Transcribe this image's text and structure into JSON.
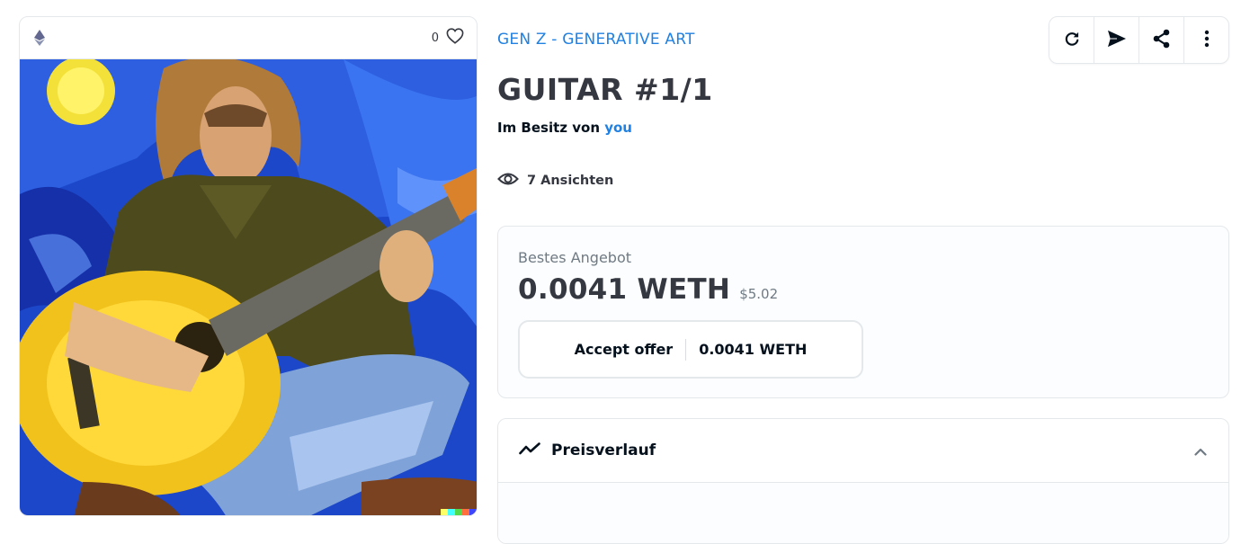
{
  "item": {
    "favorites_count": "0",
    "collection_name": "GEN Z - GENERATIVE ART",
    "title": "GUITAR #1/1",
    "owner_prefix": "Im Besitz von ",
    "owner_name": "you",
    "views_text": "7 Ansichten"
  },
  "toolbar": {
    "buttons": [
      "refresh-icon",
      "send-icon",
      "share-icon",
      "more-vertical-icon"
    ]
  },
  "offer": {
    "label": "Bestes Angebot",
    "amount": "0.0041 WETH",
    "usd": "$5.02",
    "accept_label": "Accept offer",
    "accept_amount": "0.0041 WETH"
  },
  "history": {
    "title": "Preisverlauf",
    "expanded": true
  },
  "colors": {
    "accent": "#2081e2",
    "text": "#353840",
    "border": "#e5e8eb"
  }
}
